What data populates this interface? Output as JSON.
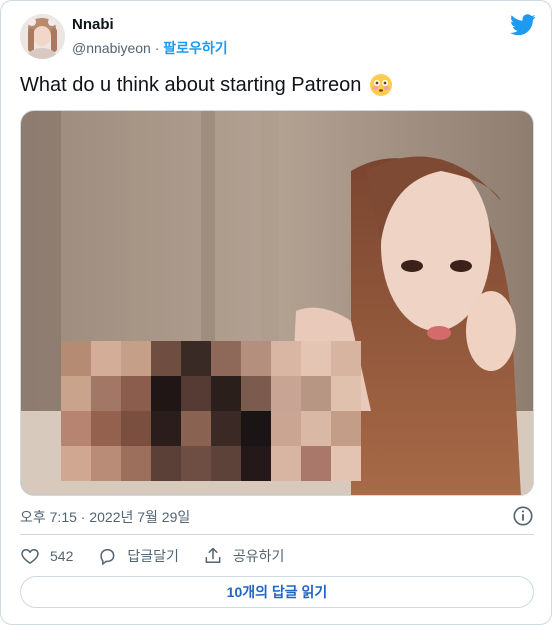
{
  "user": {
    "display_name": "Nnabi",
    "handle": "@nnabiyeon",
    "separator": "·",
    "follow_label": "팔로우하기"
  },
  "tweet": {
    "text": "What do u think about starting Patreon",
    "emoji": "flushed-face-icon",
    "timestamp": "오후 7:15 · 2022년 7월 29일"
  },
  "actions": {
    "like_count": "542",
    "reply_label": "답글달기",
    "share_label": "공유하기"
  },
  "replies_button": {
    "label": "10개의 답글 읽기"
  },
  "colors": {
    "accent": "#1d9bf0",
    "link": "#1d66c4",
    "muted_text": "#536471",
    "border": "#cfd9de"
  }
}
